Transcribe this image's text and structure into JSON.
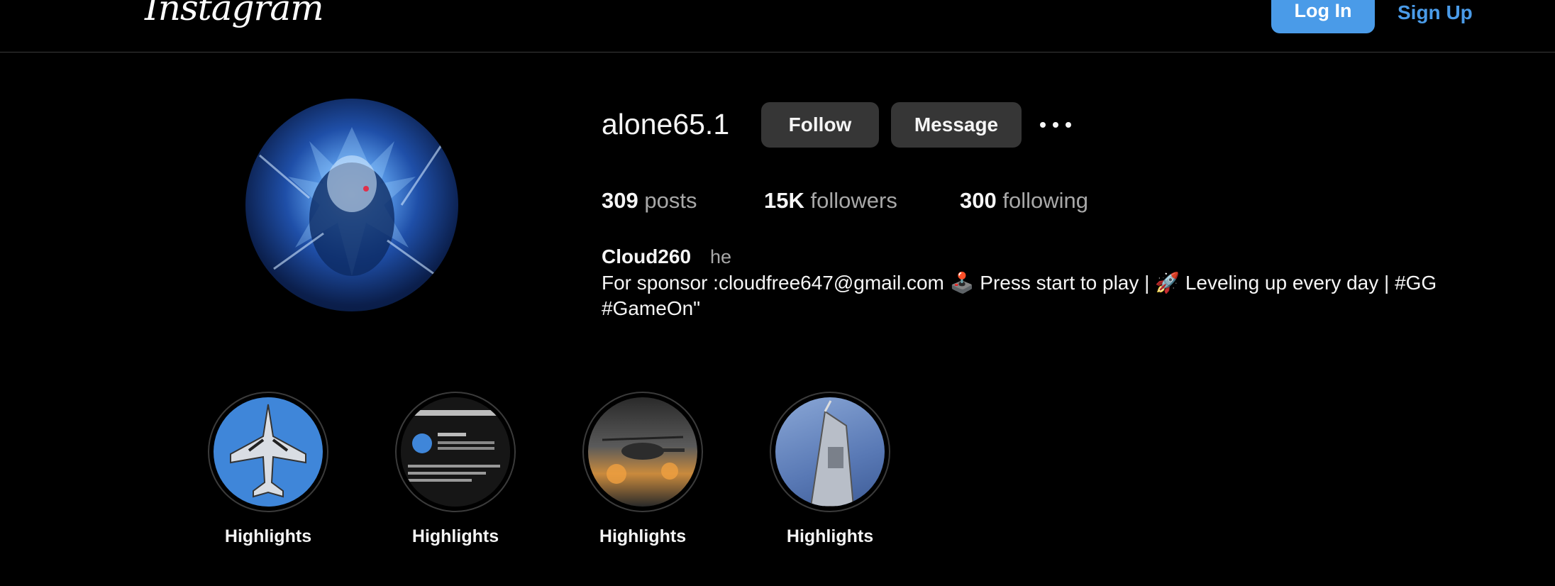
{
  "header": {
    "logo_text": "Instagram",
    "login_label": "Log In",
    "signup_label": "Sign Up"
  },
  "profile": {
    "username": "alone65.1",
    "follow_label": "Follow",
    "message_label": "Message",
    "more_icon": "more-horizontal-icon",
    "stats": {
      "posts_count": "309",
      "posts_label": "posts",
      "followers_count": "15K",
      "followers_label": "followers",
      "following_count": "300",
      "following_label": "following"
    },
    "full_name": "Cloud260",
    "pronoun": "he",
    "bio": "For sponsor :cloudfree647@gmail.com 🕹️ Press start to play | 🚀 Leveling up every day | #GG #GameOn\""
  },
  "highlights": [
    {
      "label": "Highlights"
    },
    {
      "label": "Highlights"
    },
    {
      "label": "Highlights"
    },
    {
      "label": "Highlights"
    }
  ],
  "colors": {
    "background": "#000000",
    "accent": "#4a9be8",
    "button_bg": "#363636",
    "muted_text": "#a8a8a8"
  }
}
